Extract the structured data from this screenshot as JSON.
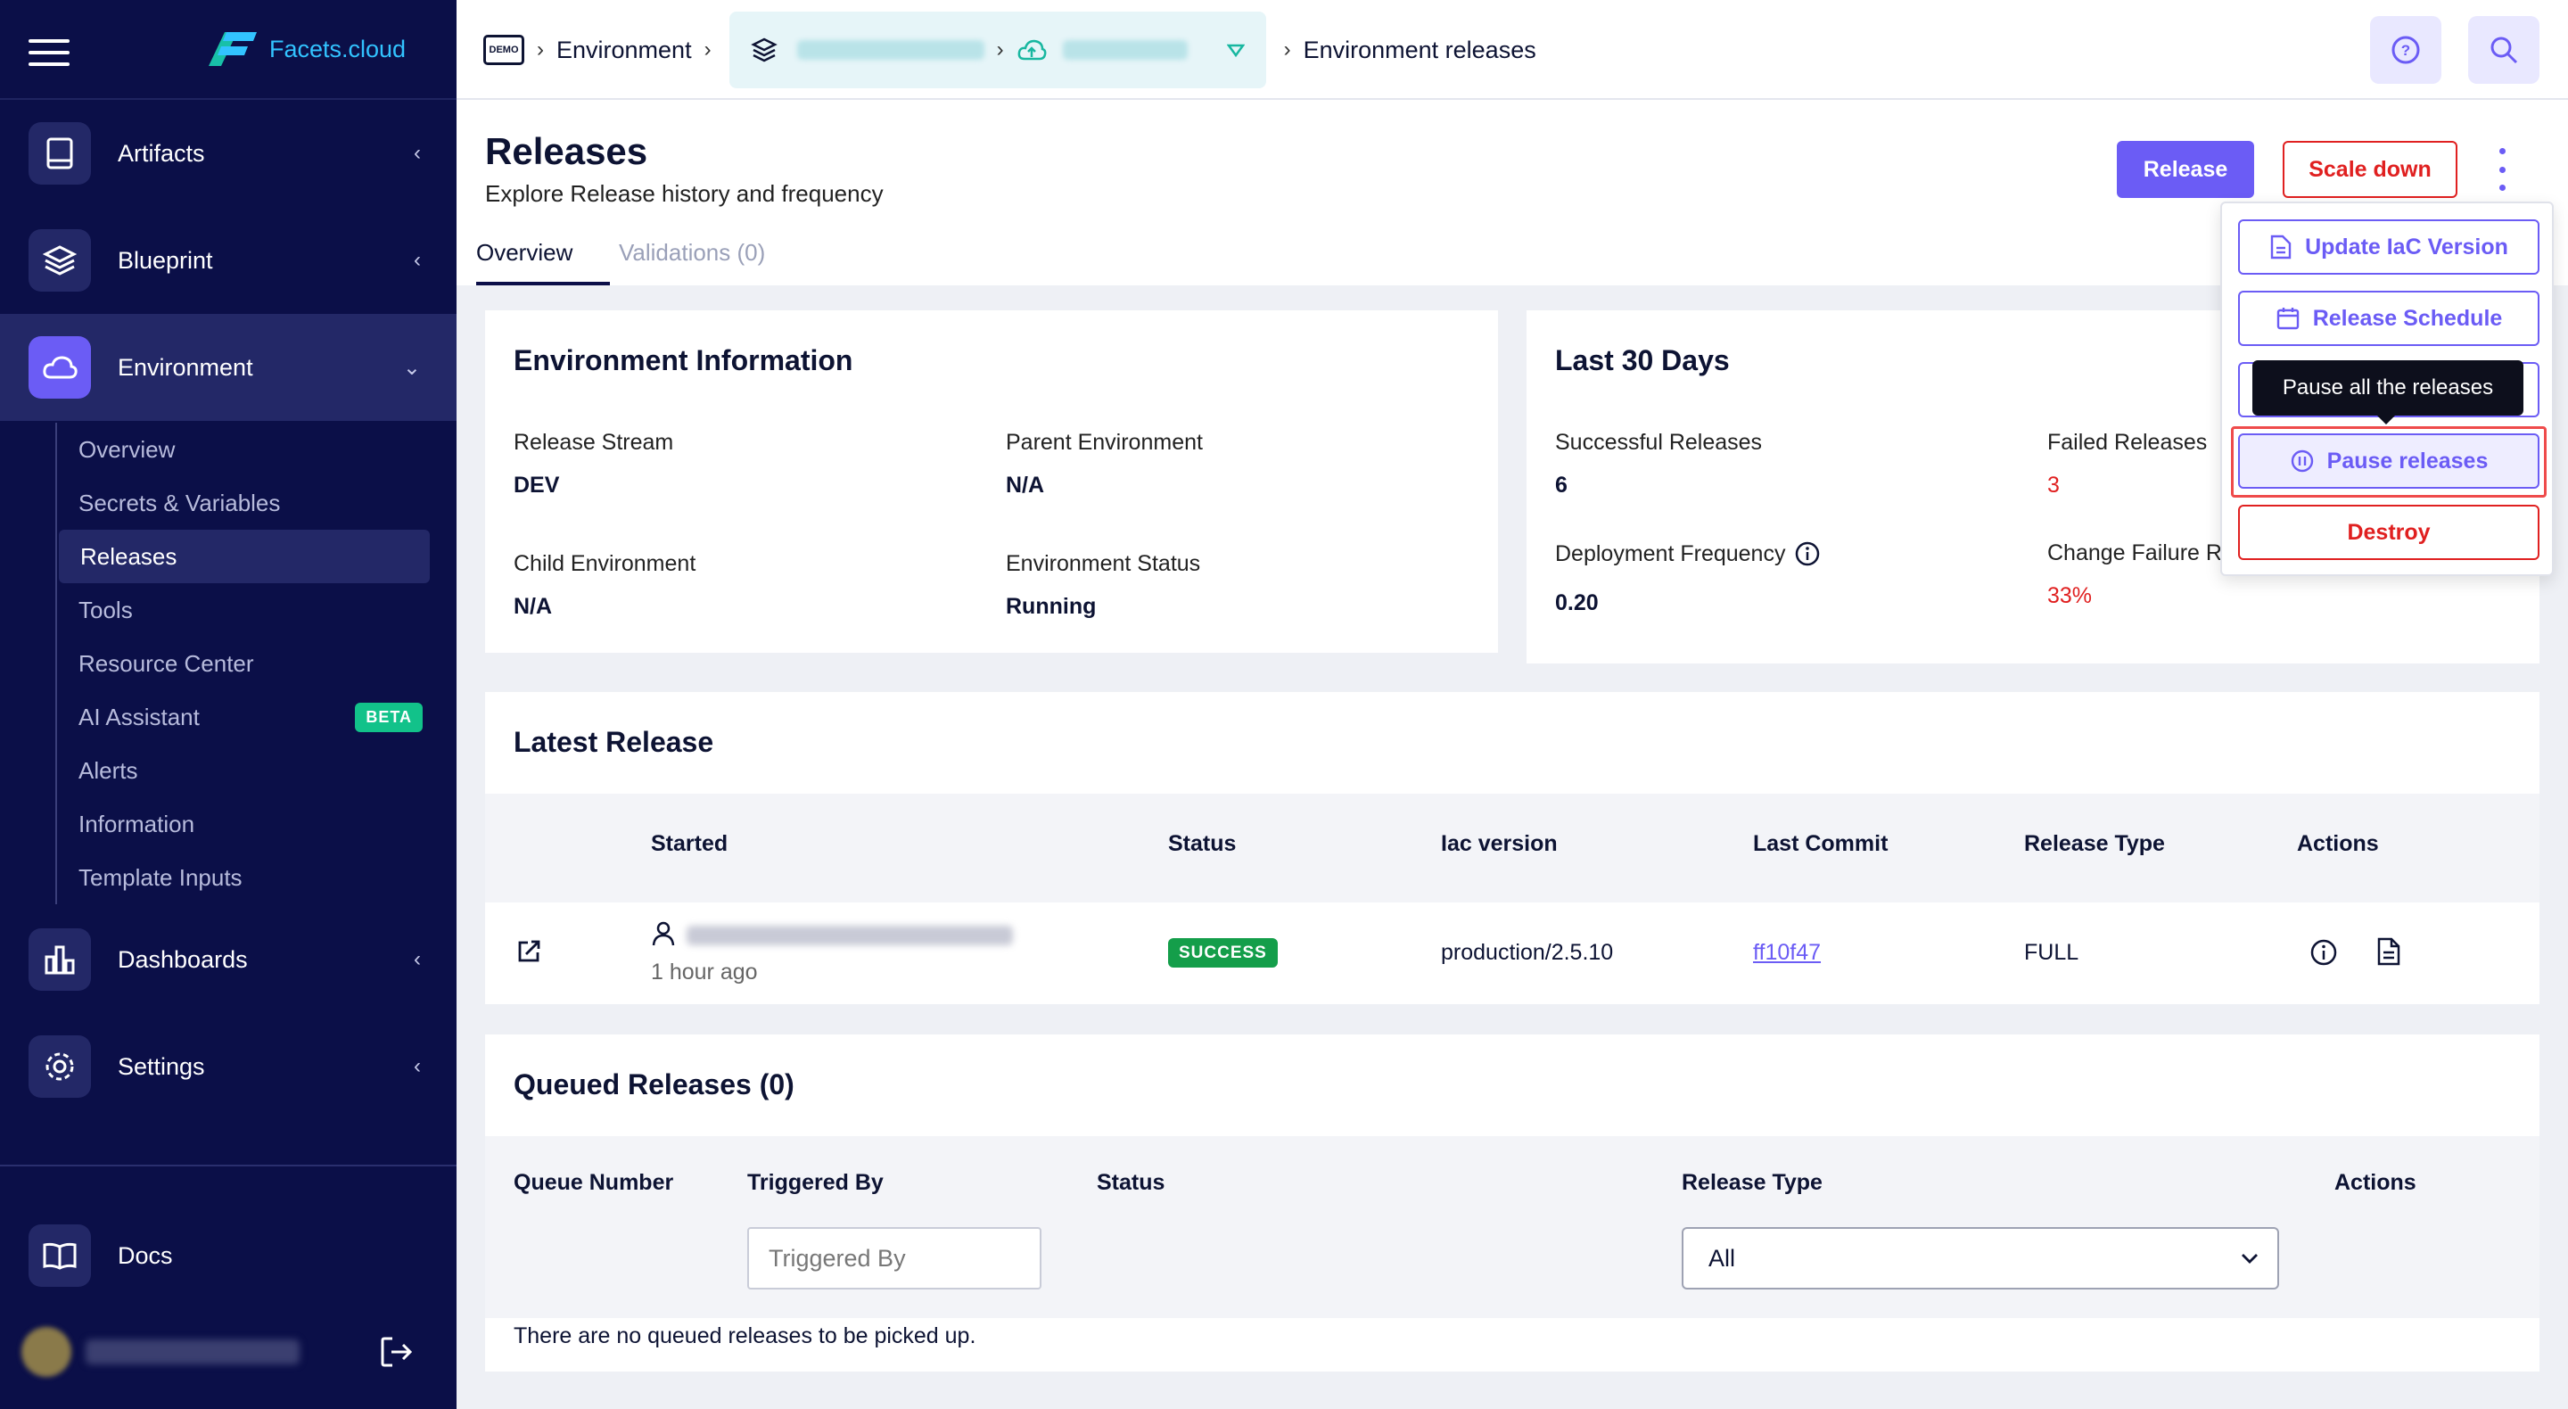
{
  "app": {
    "logo_text": "Facets.cloud"
  },
  "sidebar": {
    "items": [
      {
        "label": "Artifacts"
      },
      {
        "label": "Blueprint"
      },
      {
        "label": "Environment"
      },
      {
        "label": "Dashboards"
      },
      {
        "label": "Settings"
      },
      {
        "label": "Docs"
      }
    ],
    "environment_sub": [
      {
        "label": "Overview"
      },
      {
        "label": "Secrets & Variables"
      },
      {
        "label": "Releases"
      },
      {
        "label": "Tools"
      },
      {
        "label": "Resource Center"
      },
      {
        "label": "AI Assistant",
        "badge": "BETA"
      },
      {
        "label": "Alerts"
      },
      {
        "label": "Information"
      },
      {
        "label": "Template Inputs"
      }
    ]
  },
  "header": {
    "crumb_demo_badge": "DEMO",
    "crumb_environment": "Environment",
    "crumb_current": "Environment releases"
  },
  "page": {
    "title": "Releases",
    "subtitle": "Explore Release history and frequency",
    "tabs": [
      {
        "label": "Overview"
      },
      {
        "label": "Validations (0)"
      }
    ],
    "release_button": "Release",
    "scale_down_button": "Scale down"
  },
  "env_info": {
    "title": "Environment Information",
    "release_stream_label": "Release Stream",
    "release_stream_value": "DEV",
    "parent_env_label": "Parent Environment",
    "parent_env_value": "N/A",
    "child_env_label": "Child Environment",
    "child_env_value": "N/A",
    "env_status_label": "Environment Status",
    "env_status_value": "Running"
  },
  "last30": {
    "title": "Last 30 Days",
    "successful_label": "Successful Releases",
    "successful_value": "6",
    "failed_label": "Failed Releases",
    "failed_value": "3",
    "deploy_freq_label": "Deployment Frequency",
    "deploy_freq_value": "0.20",
    "change_failure_label": "Change Failure R",
    "change_failure_value": "33%"
  },
  "latest_release": {
    "title": "Latest Release",
    "columns": [
      "Started",
      "Status",
      "Iac version",
      "Last Commit",
      "Release Type",
      "Actions"
    ],
    "row": {
      "started_time": "1 hour ago",
      "status": "SUCCESS",
      "iac_version": "production/2.5.10",
      "last_commit": "ff10f47",
      "release_type": "FULL"
    }
  },
  "queued": {
    "title": "Queued Releases (0)",
    "columns": [
      "Queue Number",
      "Triggered By",
      "Status",
      "Release Type",
      "Actions"
    ],
    "triggered_by_placeholder": "Triggered By",
    "release_type_selected": "All",
    "empty_message": "There are no queued releases to be picked up."
  },
  "dropdown": {
    "items": [
      {
        "label": "Update IaC Version"
      },
      {
        "label": "Release Schedule"
      },
      {
        "label": "Pause releases"
      },
      {
        "label": "Destroy"
      }
    ],
    "tooltip": "Pause all the releases"
  },
  "colors": {
    "sidebar_bg": "#0b0f48",
    "accent": "#6b5cf5",
    "danger": "#e02020",
    "success": "#149e4a"
  }
}
